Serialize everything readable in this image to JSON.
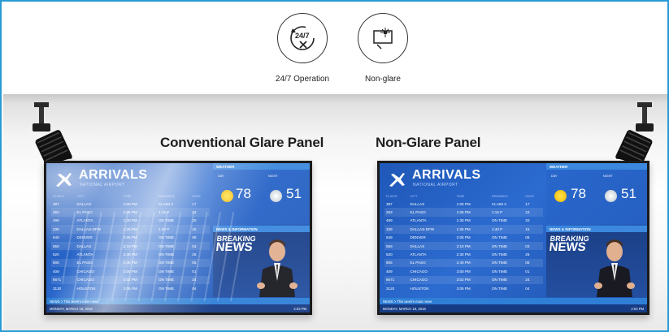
{
  "features": [
    {
      "label": "24/7 Operation",
      "icon": "24-7-operation-icon"
    },
    {
      "label": "Non-glare",
      "icon": "non-glare-icon"
    }
  ],
  "badge_text": "24/7",
  "panels": {
    "left_title": "Conventional Glare Panel",
    "right_title": "Non-Glare Panel"
  },
  "screen": {
    "title": "ARRIVALS",
    "subtitle": "NATIONAL AIRPORT",
    "columns": [
      "FLIGHT",
      "CITY",
      "TIME",
      "REMARKS",
      "GATE"
    ],
    "rows": [
      [
        "387",
        "DALLAS",
        "1:00 PM",
        "CLAIM 3",
        "17"
      ],
      [
        "263",
        "EL PASO",
        "1:05 PM",
        "1:15 P",
        "23"
      ],
      [
        "499",
        "ATLANTA",
        "1:30 PM",
        "ON TIME",
        "20"
      ],
      [
        "339",
        "DALLAS-DFW",
        "1:25 PM",
        "1:40 P",
        "15"
      ],
      [
        "649",
        "DENVER",
        "2:05 PM",
        "ON TIME",
        "08"
      ],
      [
        "559",
        "DALLAS",
        "2:10 PM",
        "ON TIME",
        "03"
      ],
      [
        "520",
        "ATLANTA",
        "2:30 PM",
        "ON TIME",
        "26"
      ],
      [
        "905",
        "EL PASO",
        "2:40 PM",
        "ON TIME",
        "05"
      ],
      [
        "409",
        "CHICAGO",
        "3:00 PM",
        "ON TIME",
        "01"
      ],
      [
        "6671",
        "CHICAGO",
        "3:02 PM",
        "ON TIME",
        "24"
      ],
      [
        "3120",
        "HOUSTON",
        "3:05 PM",
        "ON TIME",
        "04"
      ]
    ],
    "weather_label": "WEATHER",
    "day_label": "DAY",
    "night_label": "NIGHT",
    "day_temp": "78",
    "night_temp": "51",
    "news_label": "NEWS & INFORMATION",
    "breaking_top": "BREAKING",
    "breaking_bottom": "NEWS",
    "ticker": "NEWS  >  This week's main news",
    "date": "MONDAY, MARCH 18, 2018",
    "time": "2:03 PM"
  }
}
